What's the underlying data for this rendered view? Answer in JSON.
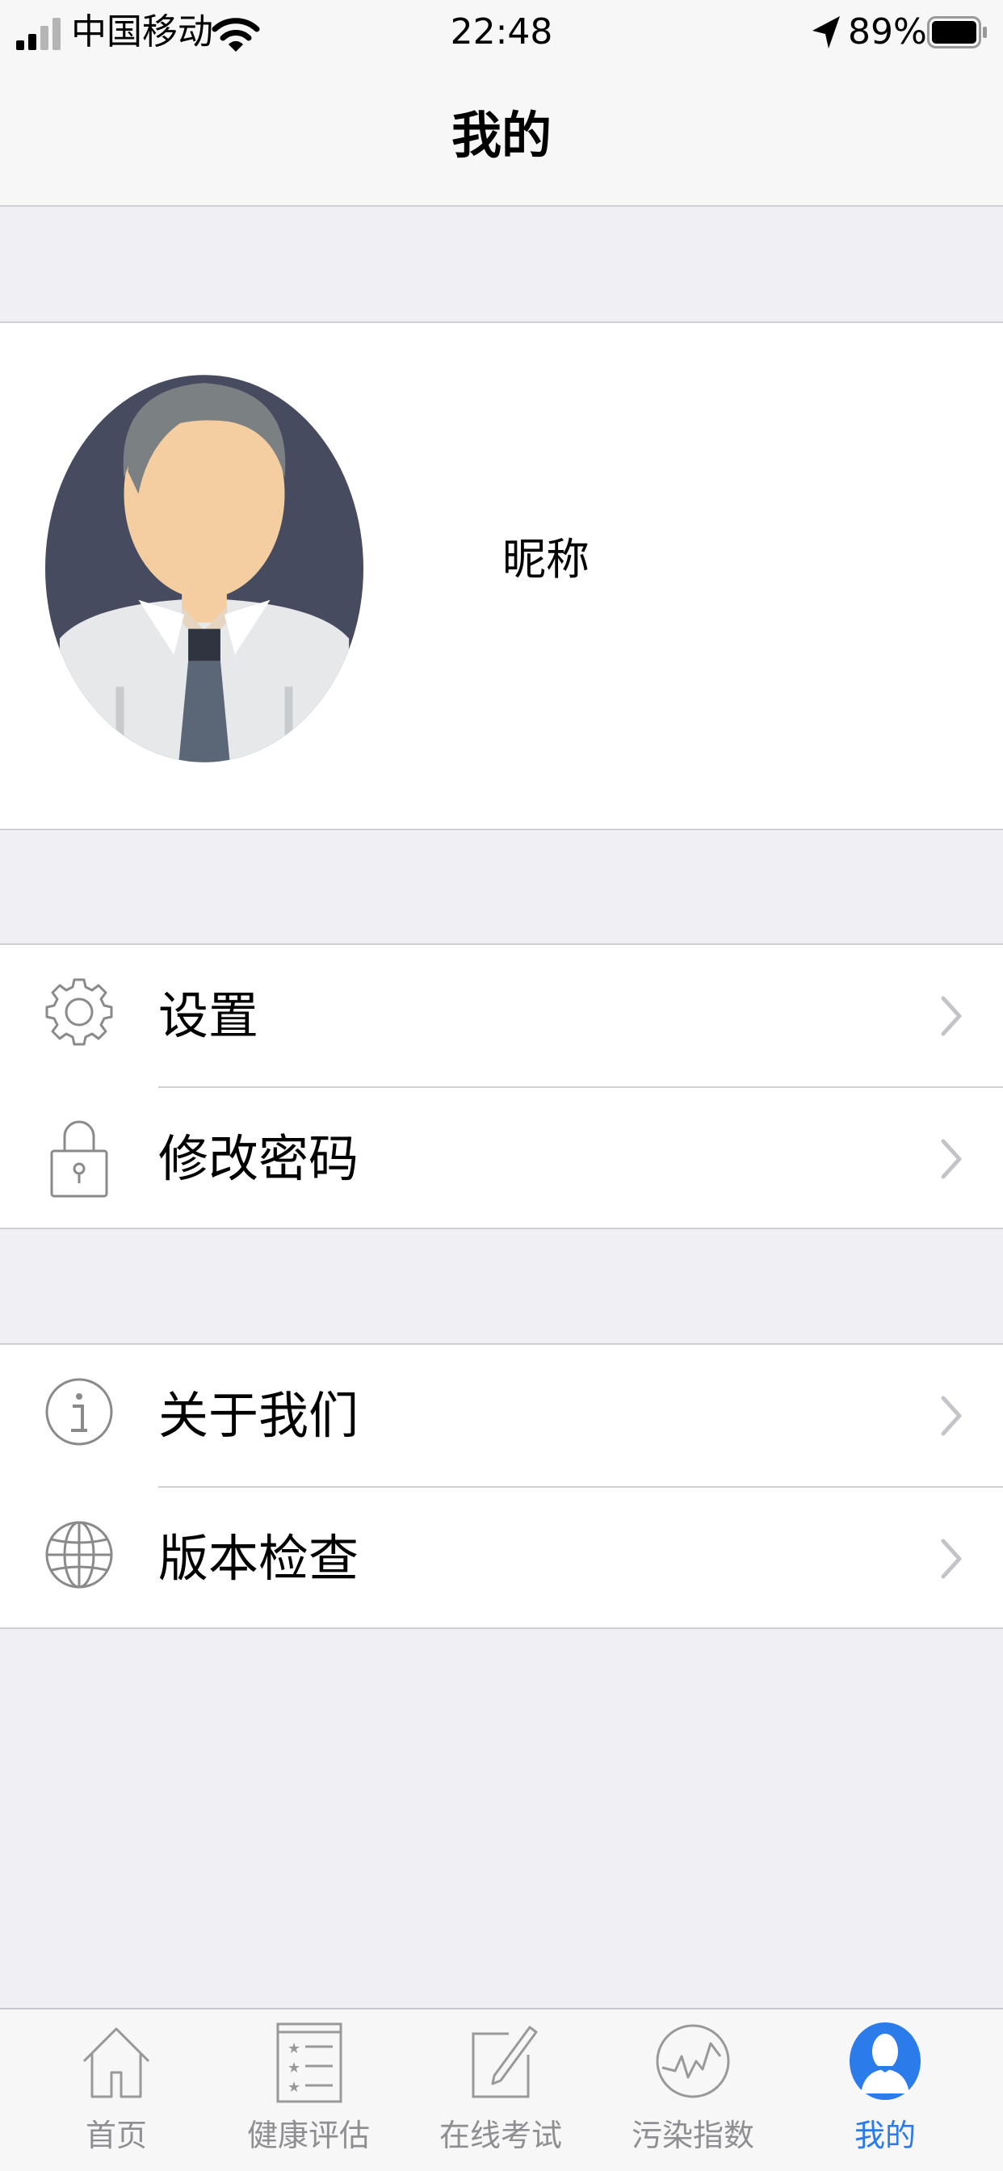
{
  "status_bar": {
    "carrier": "中国移动",
    "time": "22:48",
    "battery_percent": "89%",
    "battery_level": 0.89
  },
  "nav": {
    "title": "我的"
  },
  "profile": {
    "nickname": "昵称"
  },
  "menu_group_1": [
    {
      "label": "设置",
      "icon": "gear-icon"
    },
    {
      "label": "修改密码",
      "icon": "lock-icon"
    }
  ],
  "menu_group_2": [
    {
      "label": "关于我们",
      "icon": "info-icon"
    },
    {
      "label": "版本检查",
      "icon": "globe-icon"
    }
  ],
  "tabs": [
    {
      "label": "首页",
      "icon": "home-icon",
      "active": false
    },
    {
      "label": "健康评估",
      "icon": "checklist-icon",
      "active": false
    },
    {
      "label": "在线考试",
      "icon": "exam-edit-icon",
      "active": false
    },
    {
      "label": "污染指数",
      "icon": "pollution-chart-icon",
      "active": false
    },
    {
      "label": "我的",
      "icon": "user-icon",
      "active": true
    }
  ],
  "colors": {
    "accent": "#2b7bea",
    "tab_inactive": "#8e8e93",
    "background": "#efeff4",
    "icon_gray": "#8a8a8a"
  }
}
